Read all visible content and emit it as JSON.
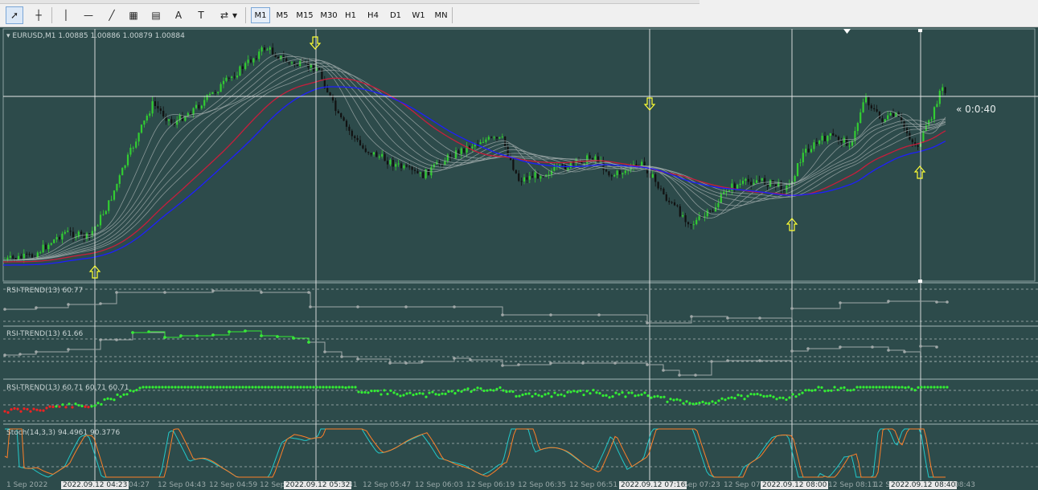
{
  "toolbar": {
    "tools": [
      {
        "name": "cursor-icon",
        "glyph": "➚"
      },
      {
        "name": "crosshair-icon",
        "glyph": "┼"
      },
      {
        "name": "vertical-line-icon",
        "glyph": "│"
      },
      {
        "name": "horizontal-line-icon",
        "glyph": "—"
      },
      {
        "name": "trendline-icon",
        "glyph": "╱"
      },
      {
        "name": "equidistant-channel-icon",
        "glyph": "▦"
      },
      {
        "name": "fibonacci-icon",
        "glyph": "▤"
      },
      {
        "name": "text-icon",
        "glyph": "A"
      },
      {
        "name": "text-label-icon",
        "glyph": "T"
      },
      {
        "name": "arrows-icon",
        "glyph": "⇄"
      }
    ],
    "timeframes": [
      "M1",
      "M5",
      "M15",
      "M30",
      "H1",
      "H4",
      "D1",
      "W1",
      "MN"
    ],
    "active_timeframe": "M1"
  },
  "chart": {
    "header": "EURUSD,M1  1.00885 1.00886 1.00879 1.00884",
    "countdown": "« 0:0:40",
    "background": "#2d4b4b",
    "bull_color": "#32cd32",
    "bear_color": "#000000",
    "ma_slow_color": "#1e1eff",
    "ma_red_color": "#c81e3c"
  },
  "indicators": {
    "rsi1": "RSI-TREND(13) 60.77",
    "rsi2": "RSI-TREND(13) 61.66",
    "rsi3": "RSI-TREND(13) 60.71 60.71 60.71",
    "stoch": "Stoch(14,3,3) 94.4961 90.3776"
  },
  "time_axis": [
    {
      "text": "1 Sep 2022",
      "hl": false
    },
    {
      "text": "2022.09.12 04:23",
      "hl": true
    },
    {
      "text": "04:27",
      "hl": false
    },
    {
      "text": "12 Sep 04:43",
      "hl": false
    },
    {
      "text": "12 Sep 04:59",
      "hl": false
    },
    {
      "text": "12 Sep 05",
      "hl": false
    },
    {
      "text": "2022.09.12 05:32",
      "hl": true
    },
    {
      "text": "31",
      "hl": false
    },
    {
      "text": "12 Sep 05:47",
      "hl": false
    },
    {
      "text": "12 Sep 06:03",
      "hl": false
    },
    {
      "text": "12 Sep 06:19",
      "hl": false
    },
    {
      "text": "12 Sep 06:35",
      "hl": false
    },
    {
      "text": "12 Sep 06:51",
      "hl": false
    },
    {
      "text": "2022.09.12 07:16",
      "hl": true
    },
    {
      "text": "Sep 07:23",
      "hl": false
    },
    {
      "text": "12 Sep 07",
      "hl": false
    },
    {
      "text": "2022.09.12 08:00",
      "hl": true
    },
    {
      "text": "12 Sep 08:11",
      "hl": false
    },
    {
      "text": "12 Sep",
      "hl": false
    },
    {
      "text": "2022.09.12 08:40",
      "hl": true
    },
    {
      "text": "08:43",
      "hl": false
    }
  ]
}
